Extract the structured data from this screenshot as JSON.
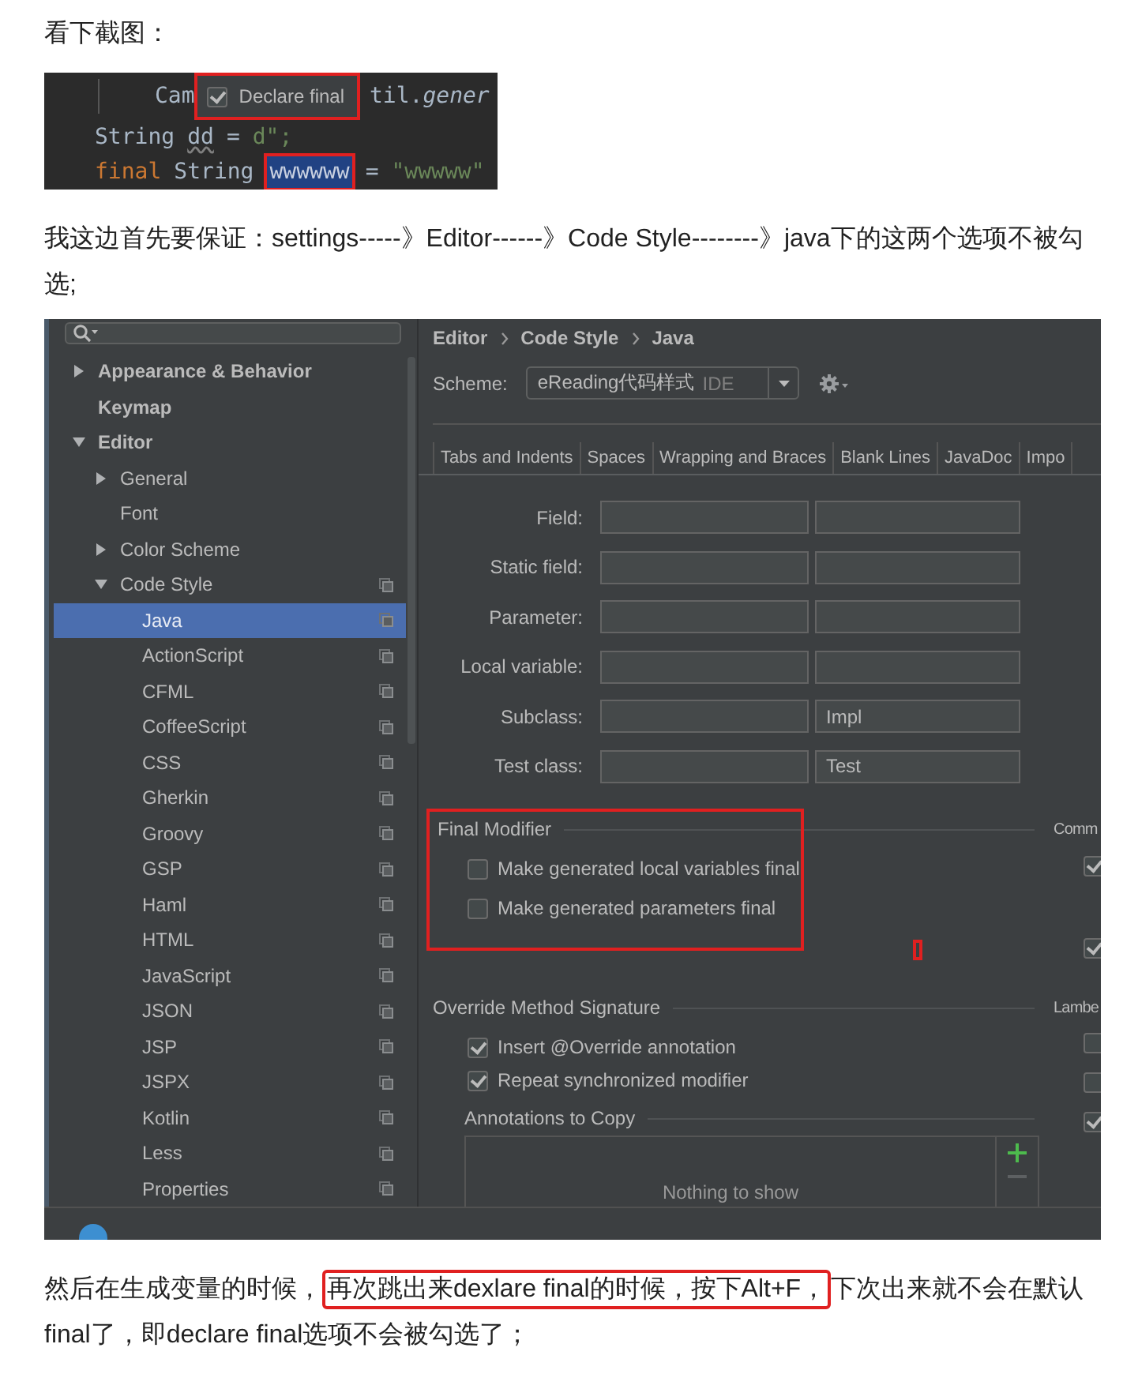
{
  "intro": "看下截图：",
  "code_screenshot": {
    "lines": [
      {
        "tokens": [
          {
            "kind": "indent-guide"
          },
          {
            "kind": "plain",
            "text": "Cam"
          },
          {
            "kind": "popup",
            "label": "Declare final",
            "checked": true,
            "annotated": true
          },
          {
            "kind": "plain",
            "text": "til.*gener*"
          }
        ]
      },
      {
        "tokens": [
          {
            "kind": "plain",
            "text": "String"
          },
          {
            "kind": "squiggle",
            "text": "dd"
          },
          {
            "kind": "plain",
            "text": "="
          },
          {
            "kind": "string",
            "text": "d\";"
          }
        ]
      },
      {
        "tokens": [
          {
            "kind": "keyword",
            "text": "final"
          },
          {
            "kind": "plain",
            "text": "String"
          },
          {
            "kind": "selection",
            "text": "wwwwww",
            "annotated": true
          },
          {
            "kind": "plain",
            "text": "="
          },
          {
            "kind": "string",
            "text": "\"wwwww\""
          }
        ]
      }
    ]
  },
  "instruction": "我这边首先要保证：settings-----》Editor------》Code Style--------》java下的这两个选项不被勾选;",
  "settings_screenshot": {
    "tree": [
      {
        "label": "Appearance & Behavior",
        "expanded": false,
        "selected": false
      },
      {
        "label": "Keymap",
        "selected": false
      },
      {
        "label": "Editor",
        "expanded": true,
        "selected": false,
        "children": [
          {
            "label": "General",
            "expanded": false,
            "selected": false
          },
          {
            "label": "Font",
            "selected": false
          },
          {
            "label": "Color Scheme",
            "expanded": false,
            "selected": false
          },
          {
            "label": "Code Style",
            "expanded": true,
            "selected": false,
            "copy_icon": true,
            "children": [
              {
                "label": "Java",
                "selected": true,
                "copy_icon": true
              },
              {
                "label": "ActionScript",
                "selected": false,
                "copy_icon": true
              },
              {
                "label": "CFML",
                "selected": false,
                "copy_icon": true
              },
              {
                "label": "CoffeeScript",
                "selected": false,
                "copy_icon": true
              },
              {
                "label": "CSS",
                "selected": false,
                "copy_icon": true
              },
              {
                "label": "Gherkin",
                "selected": false,
                "copy_icon": true
              },
              {
                "label": "Groovy",
                "selected": false,
                "copy_icon": true
              },
              {
                "label": "GSP",
                "selected": false,
                "copy_icon": true
              },
              {
                "label": "Haml",
                "selected": false,
                "copy_icon": true
              },
              {
                "label": "HTML",
                "selected": false,
                "copy_icon": true
              },
              {
                "label": "JavaScript",
                "selected": false,
                "copy_icon": true
              },
              {
                "label": "JSON",
                "selected": false,
                "copy_icon": true
              },
              {
                "label": "JSP",
                "selected": false,
                "copy_icon": true
              },
              {
                "label": "JSPX",
                "selected": false,
                "copy_icon": true
              },
              {
                "label": "Kotlin",
                "selected": false,
                "copy_icon": true
              },
              {
                "label": "Less",
                "selected": false,
                "copy_icon": true
              },
              {
                "label": "Properties",
                "selected": false,
                "copy_icon": true
              }
            ]
          }
        ]
      }
    ],
    "breadcrumb": [
      "Editor",
      "Code Style",
      "Java"
    ],
    "scheme": {
      "label": "Scheme:",
      "value": "eReading代码样式",
      "tag": "IDE"
    },
    "tabs": [
      "Tabs and Indents",
      "Spaces",
      "Wrapping and Braces",
      "Blank Lines",
      "JavaDoc",
      "Impo"
    ],
    "naming_rows": [
      {
        "label": "Field:"
      },
      {
        "label": "Static field:"
      },
      {
        "label": "Parameter:"
      },
      {
        "label": "Local variable:"
      },
      {
        "label": "Subclass:",
        "column_2": "Impl"
      },
      {
        "label": "Test class:",
        "column_2": "Test"
      }
    ],
    "final_modifier": {
      "title": "Final Modifier",
      "annotated": true,
      "options": [
        {
          "label": "Make generated local variables final",
          "checked": false
        },
        {
          "label": "Make generated parameters final",
          "checked": false
        }
      ]
    },
    "override_signature": {
      "title": "Override Method Signature",
      "options": [
        {
          "label": "Insert @Override annotation",
          "checked": true
        },
        {
          "label": "Repeat synchronized modifier",
          "checked": true
        }
      ]
    },
    "annotations_to_copy": {
      "title": "Annotations to Copy",
      "empty_text": "Nothing to show"
    },
    "side_groups": [
      {
        "title": "Comm",
        "checkboxes": [
          {
            "checked": true
          },
          {
            "checked": true
          }
        ]
      },
      {
        "title": "Lambe",
        "checkboxes": [
          {
            "checked": false
          },
          {
            "checked": false
          },
          {
            "checked": true
          }
        ]
      }
    ]
  },
  "conclusion": {
    "parts": [
      {
        "text": "然后在生成变量的时候，",
        "boxed": false
      },
      {
        "text": "再次跳出来dexlare final的时候，按下Alt+F，",
        "boxed": true
      },
      {
        "text": "下次出来就不会在默认final了，即declare final选项不会被勾选了；",
        "boxed": false
      }
    ]
  }
}
